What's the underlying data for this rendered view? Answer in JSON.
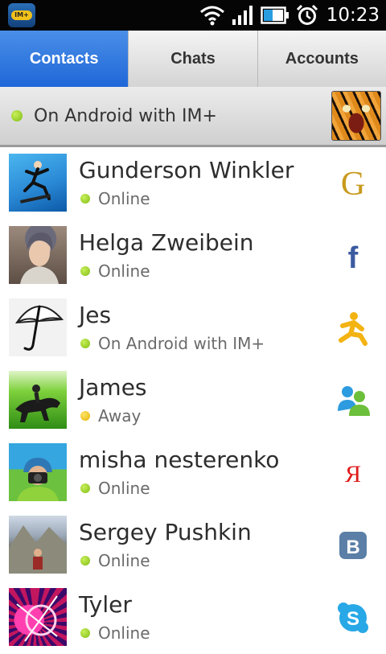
{
  "status_bar": {
    "app_icon_text": "IM+",
    "time": "10:23"
  },
  "tabs": [
    {
      "label": "Contacts",
      "active": true
    },
    {
      "label": "Chats",
      "active": false
    },
    {
      "label": "Accounts",
      "active": false
    }
  ],
  "account": {
    "status_text": "On Android with IM+",
    "status_color": "#8cc61e"
  },
  "contacts": [
    {
      "name": "Gunderson Winkler",
      "status": "Online",
      "status_color": "#8cc61e",
      "service": "google-talk-icon"
    },
    {
      "name": "Helga Zweibein",
      "status": "Online",
      "status_color": "#8cc61e",
      "service": "facebook-icon"
    },
    {
      "name": "Jes",
      "status": "On Android with IM+",
      "status_color": "#8cc61e",
      "service": "aim-icon"
    },
    {
      "name": "James",
      "status": "Away",
      "status_color": "#e8c000",
      "service": "msn-icon"
    },
    {
      "name": "misha nesterenko",
      "status": "Online",
      "status_color": "#8cc61e",
      "service": "yandex-icon"
    },
    {
      "name": "Sergey Pushkin",
      "status": "Online",
      "status_color": "#8cc61e",
      "service": "vkontakte-icon"
    },
    {
      "name": "Tyler",
      "status": "Online",
      "status_color": "#8cc61e",
      "service": "skype-icon"
    }
  ]
}
